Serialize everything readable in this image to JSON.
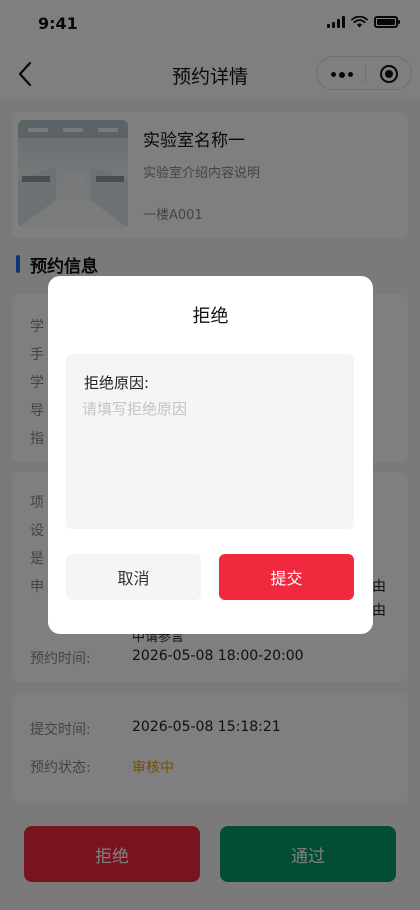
{
  "status_bar": {
    "time": "9:41"
  },
  "nav": {
    "title": "预约详情"
  },
  "lab": {
    "name": "实验室名称一",
    "description": "实验室介绍内容说明",
    "room": "一楼A001"
  },
  "section": {
    "title": "预约信息"
  },
  "card2_partial": [
    "学",
    "手",
    "学",
    "导",
    "指"
  ],
  "card3_partial": {
    "left": [
      "项",
      "设",
      "是",
      "申"
    ],
    "right": [
      "由",
      "由"
    ],
    "wrap": "中请参言"
  },
  "reserve_time": {
    "label": "预约时间:",
    "value": "2026-05-08   18:00-20:00"
  },
  "submit_time": {
    "label": "提交时间:",
    "value": "2026-05-08   15:18:21"
  },
  "status": {
    "label": "预约状态:",
    "value": "审核中"
  },
  "actions": {
    "reject": "拒绝",
    "pass": "通过"
  },
  "modal": {
    "title": "拒绝",
    "reason_label": "拒绝原因:",
    "placeholder": "请填写拒绝原因",
    "cancel": "取消",
    "submit": "提交"
  },
  "colors": {
    "primary_red": "#f0293f",
    "pass_green": "#059b6c",
    "status_orange": "#e69c16",
    "accent_blue": "#1d6fe8"
  }
}
